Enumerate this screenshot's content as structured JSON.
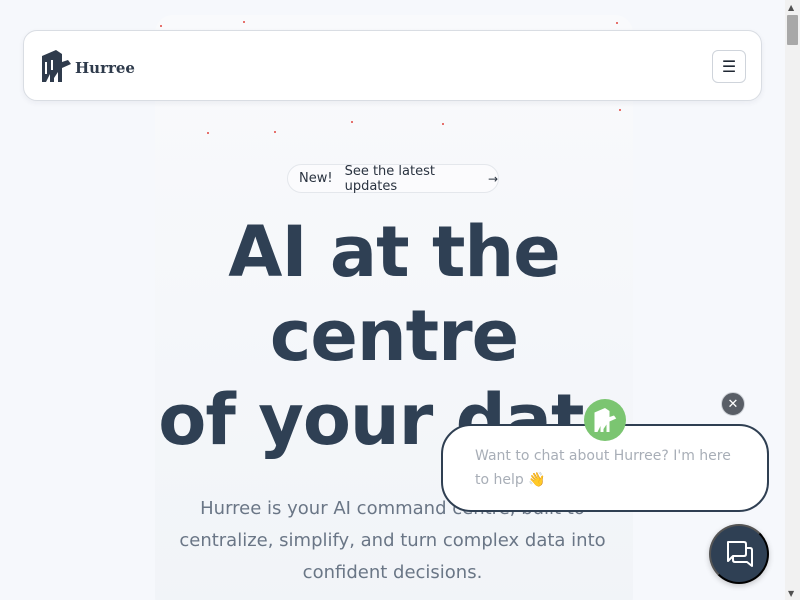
{
  "brand": {
    "name": "Hurree"
  },
  "nav": {
    "menu_icon": "☰"
  },
  "badge": {
    "new_label": "New!",
    "link_text": "See the latest updates",
    "arrow": "→"
  },
  "hero": {
    "headline_lines": [
      "AI at the",
      "centre",
      "of your data"
    ],
    "subtext": "Hurree is your AI command centre, built to centralize, simplify, and turn complex data into confident decisions."
  },
  "chat": {
    "close_icon": "✕",
    "prompt": "Want to chat about Hurree? I'm here to help 👋"
  },
  "colors": {
    "accent": "#2f4054",
    "avatar_green": "#7bc571",
    "dots": "#e0463f"
  }
}
